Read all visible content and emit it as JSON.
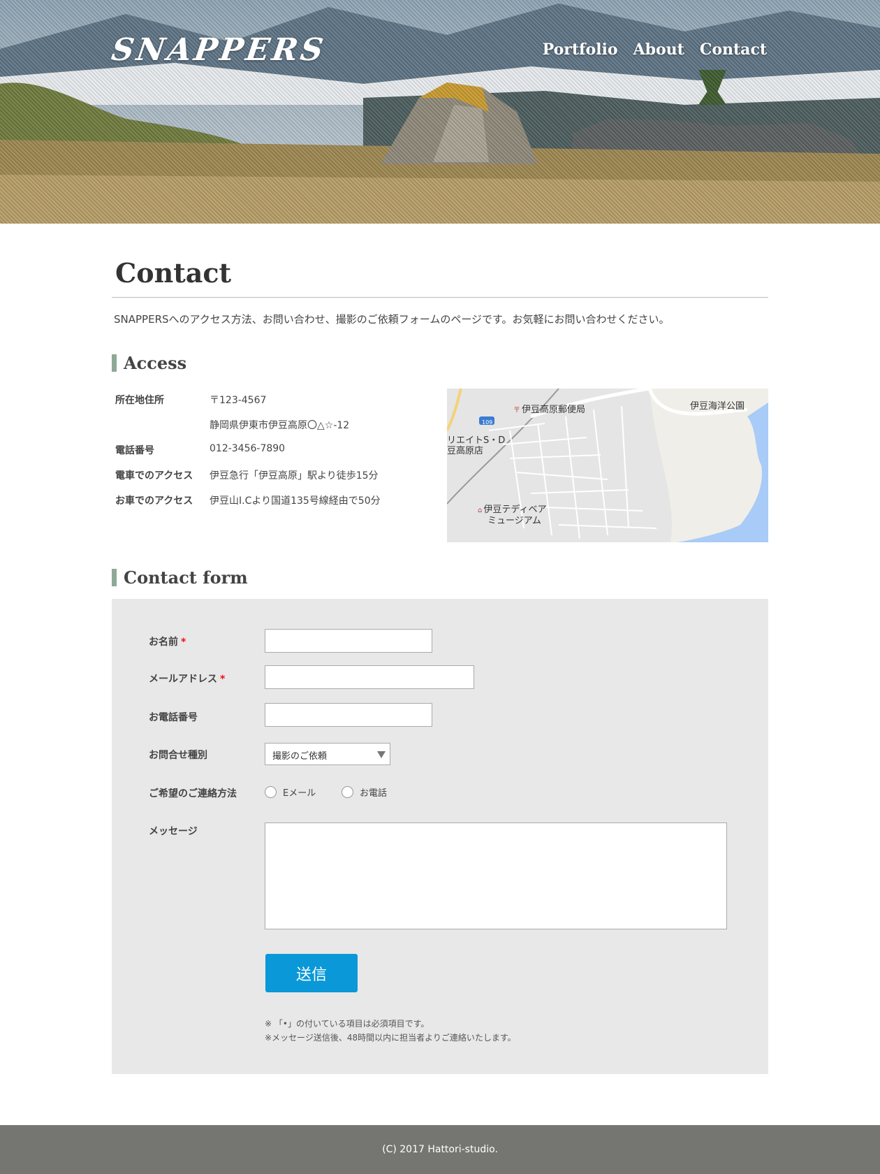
{
  "header": {
    "logo": "SNAPPERS",
    "nav": [
      "Portfolio",
      "About",
      "Contact"
    ]
  },
  "page": {
    "title": "Contact",
    "intro": "SNAPPERSへのアクセス方法、お問い合わせ、撮影のご依頼フォームのページです。お気軽にお問い合わせください。"
  },
  "access": {
    "heading": "Access",
    "rows": [
      {
        "label": "所在地住所",
        "value": "〒123-4567"
      },
      {
        "label": "",
        "value": "静岡県伊東市伊豆高原〇△☆-12"
      },
      {
        "label": "電話番号",
        "value": "012-3456-7890"
      },
      {
        "label": "電車でのアクセス",
        "value": "伊豆急行「伊豆高原」駅より徒歩15分"
      },
      {
        "label": "お車でのアクセス",
        "value": "伊豆山I.Cより国道135号線経由で50分"
      }
    ],
    "map": {
      "post_office": "伊豆高原郵便局",
      "park": "伊豆海洋公園",
      "shop_line1": "リエイトS・D",
      "shop_line2": "豆高原店",
      "museum_line1": "伊豆テディベア",
      "museum_line2": "ミュージアム",
      "route": "109"
    }
  },
  "form": {
    "heading": "Contact form",
    "name_label": "お名前",
    "email_label": "メールアドレス",
    "phone_label": "お電話番号",
    "type_label": "お問合せ種別",
    "type_selected": "撮影のご依頼",
    "method_label": "ご希望のご連絡方法",
    "method_options": [
      "Eメール",
      "お電話"
    ],
    "message_label": "メッセージ",
    "required_mark": "*",
    "submit": "送信",
    "note1": "※ 「•」の付いている項目は必須項目です。",
    "note2": "※メッセージ送信後、48時間以内に担当者よりご連絡いたします。"
  },
  "footer": {
    "copyright": "(C) 2017 Hattori-studio."
  }
}
